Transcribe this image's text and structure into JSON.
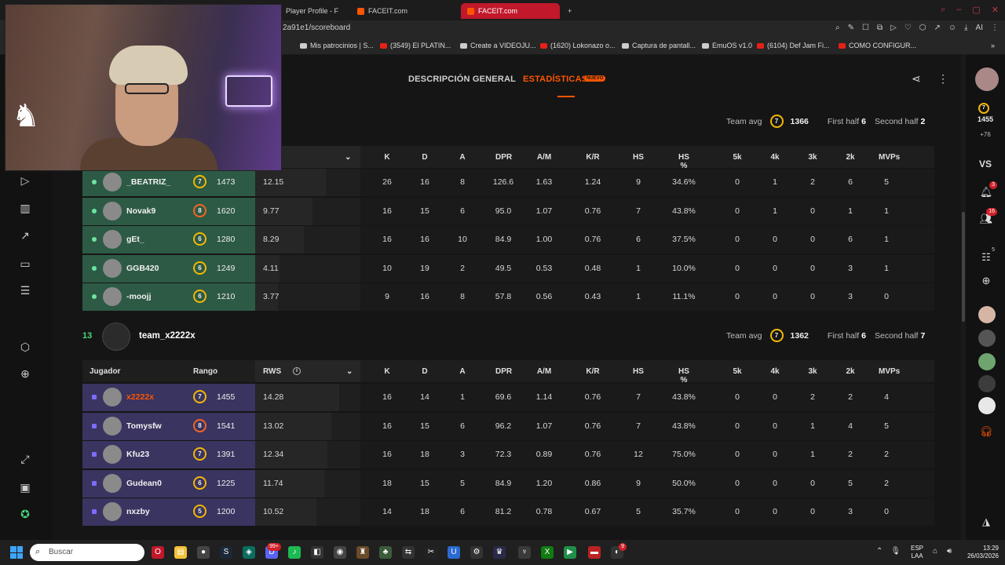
{
  "browser": {
    "tabs": [
      {
        "label": "Player Profile - F"
      },
      {
        "label": "FACEIT.com"
      },
      {
        "label": "FACEIT.com"
      }
    ],
    "url": "2a91e1/scoreboard",
    "bookmarks": [
      {
        "label": "Mis patrocinios | S..."
      },
      {
        "label": "(3549) El PLATIN..."
      },
      {
        "label": "Create a VIDEOJU..."
      },
      {
        "label": "(1620) Lokonazo o..."
      },
      {
        "label": "Captura de pantall..."
      },
      {
        "label": "EmuOS v1.0"
      },
      {
        "label": "(6104) Def Jam Fi..."
      },
      {
        "label": "COMO CONFIGUR..."
      }
    ],
    "ai_label": "AI"
  },
  "nav": {
    "overview": "DESCRIPCIÓN GENERAL",
    "stats": "ESTADÍSTICAS",
    "new_badge": "NUEVO"
  },
  "team1": {
    "team_avg_label": "Team avg",
    "avg_level": "7",
    "avg_elo": "1366",
    "first_half_label": "First half",
    "first_half": "6",
    "second_half_label": "Second half",
    "second_half": "2"
  },
  "team2": {
    "score": "13",
    "name": "team_x2222x",
    "team_avg_label": "Team avg",
    "avg_level": "7",
    "avg_elo": "1362",
    "first_half_label": "First half",
    "first_half": "6",
    "second_half_label": "Second half",
    "second_half": "7"
  },
  "columns": {
    "player": "Jugador",
    "rank": "Rango",
    "rws": "RWS",
    "k": "K",
    "d": "D",
    "a": "A",
    "dpr": "DPR",
    "am": "A/M",
    "kr": "K/R",
    "hs": "HS",
    "hsp": "HS %",
    "k5": "5k",
    "k4": "4k",
    "k3": "3k",
    "k2": "2k",
    "mvps": "MVPs"
  },
  "team1_players": [
    {
      "name": "_BEATRIZ_",
      "level": "7",
      "elo": "1473",
      "rws": "12.15",
      "rws_fraction": 0.82,
      "k": "26",
      "d": "16",
      "a": "8",
      "dpr": "126.6",
      "am": "1.63",
      "kr": "1.24",
      "hs": "9",
      "hsp": "34.6%",
      "k5": "0",
      "k4": "1",
      "k3": "2",
      "k2": "6",
      "mvps": "5"
    },
    {
      "name": "Novak9",
      "level": "8",
      "elo": "1620",
      "rws": "9.77",
      "rws_fraction": 0.66,
      "k": "16",
      "d": "15",
      "a": "6",
      "dpr": "95.0",
      "am": "1.07",
      "kr": "0.76",
      "hs": "7",
      "hsp": "43.8%",
      "k5": "0",
      "k4": "1",
      "k3": "0",
      "k2": "1",
      "mvps": "1"
    },
    {
      "name": "gEt_",
      "level": "6",
      "elo": "1280",
      "rws": "8.29",
      "rws_fraction": 0.56,
      "k": "16",
      "d": "16",
      "a": "10",
      "dpr": "84.9",
      "am": "1.00",
      "kr": "0.76",
      "hs": "6",
      "hsp": "37.5%",
      "k5": "0",
      "k4": "0",
      "k3": "0",
      "k2": "6",
      "mvps": "1"
    },
    {
      "name": "GGB420",
      "level": "6",
      "elo": "1249",
      "rws": "4.11",
      "rws_fraction": 0.28,
      "k": "10",
      "d": "19",
      "a": "2",
      "dpr": "49.5",
      "am": "0.53",
      "kr": "0.48",
      "hs": "1",
      "hsp": "10.0%",
      "k5": "0",
      "k4": "0",
      "k3": "0",
      "k2": "3",
      "mvps": "1"
    },
    {
      "name": "-moojj",
      "level": "6",
      "elo": "1210",
      "rws": "3.77",
      "rws_fraction": 0.26,
      "k": "9",
      "d": "16",
      "a": "8",
      "dpr": "57.8",
      "am": "0.56",
      "kr": "0.43",
      "hs": "1",
      "hsp": "11.1%",
      "k5": "0",
      "k4": "0",
      "k3": "0",
      "k2": "3",
      "mvps": "0"
    }
  ],
  "team2_players": [
    {
      "name": "x2222x",
      "level": "7",
      "elo": "1455",
      "rws": "14.28",
      "rws_fraction": 0.97,
      "k": "16",
      "d": "14",
      "a": "1",
      "dpr": "69.6",
      "am": "1.14",
      "kr": "0.76",
      "hs": "7",
      "hsp": "43.8%",
      "k5": "0",
      "k4": "0",
      "k3": "2",
      "k2": "2",
      "mvps": "4"
    },
    {
      "name": "Tomysfw",
      "level": "8",
      "elo": "1541",
      "rws": "13.02",
      "rws_fraction": 0.88,
      "k": "16",
      "d": "15",
      "a": "6",
      "dpr": "96.2",
      "am": "1.07",
      "kr": "0.76",
      "hs": "7",
      "hsp": "43.8%",
      "k5": "0",
      "k4": "0",
      "k3": "1",
      "k2": "4",
      "mvps": "5"
    },
    {
      "name": "Kfu23",
      "level": "7",
      "elo": "1391",
      "rws": "12.34",
      "rws_fraction": 0.84,
      "k": "16",
      "d": "18",
      "a": "3",
      "dpr": "72.3",
      "am": "0.89",
      "kr": "0.76",
      "hs": "12",
      "hsp": "75.0%",
      "k5": "0",
      "k4": "0",
      "k3": "1",
      "k2": "2",
      "mvps": "2"
    },
    {
      "name": "Gudean0",
      "level": "6",
      "elo": "1225",
      "rws": "11.74",
      "rws_fraction": 0.8,
      "k": "18",
      "d": "15",
      "a": "5",
      "dpr": "84.9",
      "am": "1.20",
      "kr": "0.86",
      "hs": "9",
      "hsp": "50.0%",
      "k5": "0",
      "k4": "0",
      "k3": "0",
      "k2": "5",
      "mvps": "2"
    },
    {
      "name": "nxzby",
      "level": "5",
      "elo": "1200",
      "rws": "10.52",
      "rws_fraction": 0.71,
      "k": "14",
      "d": "18",
      "a": "6",
      "dpr": "81.2",
      "am": "0.78",
      "kr": "0.67",
      "hs": "5",
      "hsp": "35.7%",
      "k5": "0",
      "k4": "0",
      "k3": "0",
      "k2": "3",
      "mvps": "0"
    }
  ],
  "right_sidebar": {
    "level": "7",
    "elo": "1455",
    "elo_change": "+76",
    "vs_label": "VS",
    "notif_count": "3",
    "friends_count": "16",
    "party_count": "5"
  },
  "taskbar": {
    "search_placeholder": "Buscar",
    "lang_line1": "ESP",
    "lang_line2": "LAA",
    "time": "13:29",
    "date": "26/03/2026",
    "discord_badge": "99+",
    "steam_badge": "9"
  },
  "colors": {
    "accent": "#ff5500",
    "team1_row": "#2d5a45",
    "team2_row": "#3a3460",
    "win_score": "#47d97e"
  }
}
